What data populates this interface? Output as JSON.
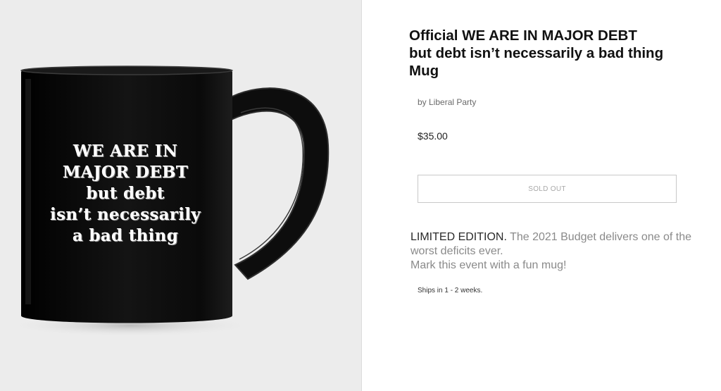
{
  "product": {
    "title_lines": [
      "Official WE ARE IN MAJOR DEBT",
      "but debt isn’t necessarily a bad thing",
      "Mug"
    ],
    "vendor": "by Liberal Party",
    "price": "$35.00",
    "button_label": "SOLD OUT",
    "description_lead": "LIMITED EDITION.",
    "description_rest": " The 2021 Budget delivers one of the worst deficits ever.",
    "description_line2": "Mark this event with a fun mug!",
    "shipping": "Ships in 1 - 2 weeks."
  },
  "mug": {
    "print_lines": [
      "WE ARE IN",
      "MAJOR DEBT",
      "but debt",
      "isn’t necessarily",
      "a bad thing"
    ],
    "body_color": "#0b0b0b"
  },
  "colors": {
    "image_background": "#ececec",
    "button_border": "#c8c8c8",
    "description_gray": "#8a8a8a"
  }
}
